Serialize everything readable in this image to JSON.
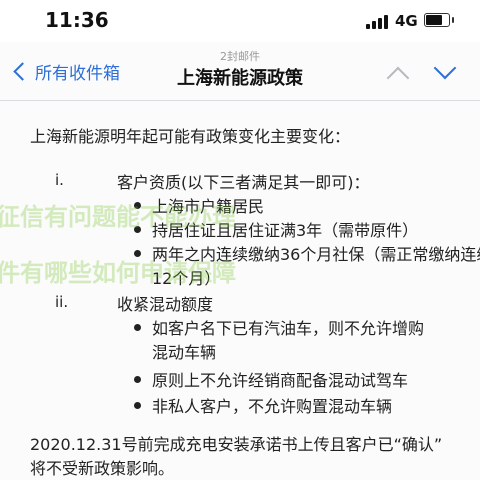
{
  "status_bar": {
    "time": "11:36",
    "network": "4G",
    "battery_level": 0.8
  },
  "nav": {
    "back_label": "所有收件箱",
    "count": "2封邮件",
    "title": "上海新能源政策",
    "accent_color": "#2d6fd6"
  },
  "body": {
    "intro": "上海新能源明年起可能有政策变化主要变化：",
    "sections": [
      {
        "roman": "i.",
        "heading": "客户资质(以下三者满足其一即可)：",
        "bullets": [
          "上海市户籍居民",
          "持居住证且居住证满3年（需带原件）",
          "两年之内连续缴纳36个月社保（需正常缴纳连续",
          "12个月）"
        ]
      },
      {
        "roman": "ii.",
        "heading": "收紧混动额度",
        "bullets": [
          "如客户名下已有汽油车，则不允许增购",
          "混动车辆",
          "原则上不允许经销商配备混动试驾车",
          "非私人客户，不允许购置混动车辆"
        ]
      }
    ],
    "note_line1": "2020.12.31号前完成充电安装承诺书上传且客户已“确认”",
    "note_line2": "将不受新政策影响。"
  },
  "watermark": {
    "line1": "征信有问题能不能办理",
    "line2": "件有哪些如何申请保障",
    "color": "#78c828"
  }
}
